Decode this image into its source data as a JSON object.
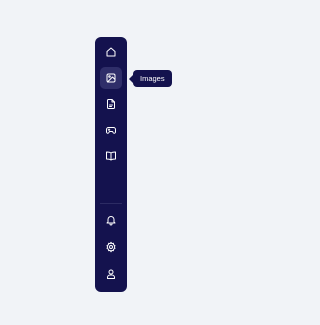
{
  "sidebar": {
    "top_items": [
      {
        "icon": "home-icon"
      },
      {
        "icon": "image-icon",
        "active": true
      },
      {
        "icon": "document-icon"
      },
      {
        "icon": "gamepad-icon"
      },
      {
        "icon": "book-icon"
      }
    ],
    "bottom_items": [
      {
        "icon": "bell-icon"
      },
      {
        "icon": "gear-icon"
      },
      {
        "icon": "user-icon"
      }
    ]
  },
  "tooltip": {
    "label": "Images"
  },
  "colors": {
    "sidebar_bg": "#14124e",
    "active_item_bg": "#2f2e69",
    "page_bg": "#f1f3f7",
    "icon": "#ffffff"
  }
}
